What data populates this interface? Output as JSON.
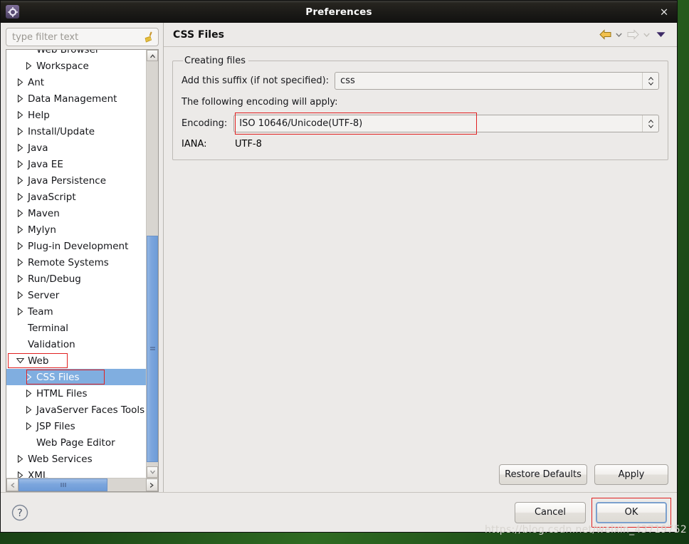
{
  "window": {
    "title": "Preferences",
    "icon": "preferences-gear-icon",
    "close_label": "×"
  },
  "filter": {
    "placeholder": "type filter text",
    "value": "",
    "clear_icon": "broom-icon"
  },
  "tree": {
    "items": [
      {
        "label": "Web Browser",
        "level": 1,
        "arrow": "none",
        "selected": false,
        "clipped": true
      },
      {
        "label": "Workspace",
        "level": 1,
        "arrow": "collapsed",
        "selected": false
      },
      {
        "label": "Ant",
        "level": 0,
        "arrow": "collapsed",
        "selected": false
      },
      {
        "label": "Data Management",
        "level": 0,
        "arrow": "collapsed",
        "selected": false
      },
      {
        "label": "Help",
        "level": 0,
        "arrow": "collapsed",
        "selected": false
      },
      {
        "label": "Install/Update",
        "level": 0,
        "arrow": "collapsed",
        "selected": false
      },
      {
        "label": "Java",
        "level": 0,
        "arrow": "collapsed",
        "selected": false
      },
      {
        "label": "Java EE",
        "level": 0,
        "arrow": "collapsed",
        "selected": false
      },
      {
        "label": "Java Persistence",
        "level": 0,
        "arrow": "collapsed",
        "selected": false
      },
      {
        "label": "JavaScript",
        "level": 0,
        "arrow": "collapsed",
        "selected": false
      },
      {
        "label": "Maven",
        "level": 0,
        "arrow": "collapsed",
        "selected": false
      },
      {
        "label": "Mylyn",
        "level": 0,
        "arrow": "collapsed",
        "selected": false
      },
      {
        "label": "Plug-in Development",
        "level": 0,
        "arrow": "collapsed",
        "selected": false
      },
      {
        "label": "Remote Systems",
        "level": 0,
        "arrow": "collapsed",
        "selected": false
      },
      {
        "label": "Run/Debug",
        "level": 0,
        "arrow": "collapsed",
        "selected": false
      },
      {
        "label": "Server",
        "level": 0,
        "arrow": "collapsed",
        "selected": false
      },
      {
        "label": "Team",
        "level": 0,
        "arrow": "collapsed",
        "selected": false
      },
      {
        "label": "Terminal",
        "level": 0,
        "arrow": "none",
        "selected": false
      },
      {
        "label": "Validation",
        "level": 0,
        "arrow": "none",
        "selected": false
      },
      {
        "label": "Web",
        "level": 0,
        "arrow": "expanded",
        "selected": false,
        "annotated": true
      },
      {
        "label": "CSS Files",
        "level": 1,
        "arrow": "collapsed",
        "selected": true,
        "annotated": true
      },
      {
        "label": "HTML Files",
        "level": 1,
        "arrow": "collapsed",
        "selected": false
      },
      {
        "label": "JavaServer Faces Tools",
        "level": 1,
        "arrow": "collapsed",
        "selected": false
      },
      {
        "label": "JSP Files",
        "level": 1,
        "arrow": "collapsed",
        "selected": false
      },
      {
        "label": "Web Page Editor",
        "level": 1,
        "arrow": "none",
        "selected": false
      },
      {
        "label": "Web Services",
        "level": 0,
        "arrow": "collapsed",
        "selected": false
      },
      {
        "label": "XML",
        "level": 0,
        "arrow": "collapsed",
        "selected": false
      }
    ],
    "selected_label": "CSS Files"
  },
  "header": {
    "title": "CSS Files",
    "back_icon": "back-arrow-icon",
    "back_caret_icon": "chevron-down-icon",
    "forward_icon": "forward-arrow-icon",
    "forward_caret_icon": "chevron-down-icon",
    "menu_icon": "view-menu-triangle-icon"
  },
  "content": {
    "group_title": "Creating files",
    "suffix_label": "Add this suffix (if not specified):",
    "suffix_value": "css",
    "encoding_note": "The following encoding will apply:",
    "encoding_label": "Encoding:",
    "encoding_value": "ISO 10646/Unicode(UTF-8)",
    "iana_label": "IANA:",
    "iana_value": "UTF-8"
  },
  "buttons": {
    "restore_defaults": "Restore Defaults",
    "apply": "Apply",
    "cancel": "Cancel",
    "ok": "OK",
    "help_icon": "help-question-icon"
  },
  "watermark": "https://blog.csdn.net/weixin_43719752",
  "colors": {
    "selection_blue": "#80aee0",
    "annotation_red": "#e02020",
    "dialog_bg": "#ECEAE8",
    "titlebar_dark": "#1b1a17",
    "focus_border": "#7ba0cd"
  }
}
